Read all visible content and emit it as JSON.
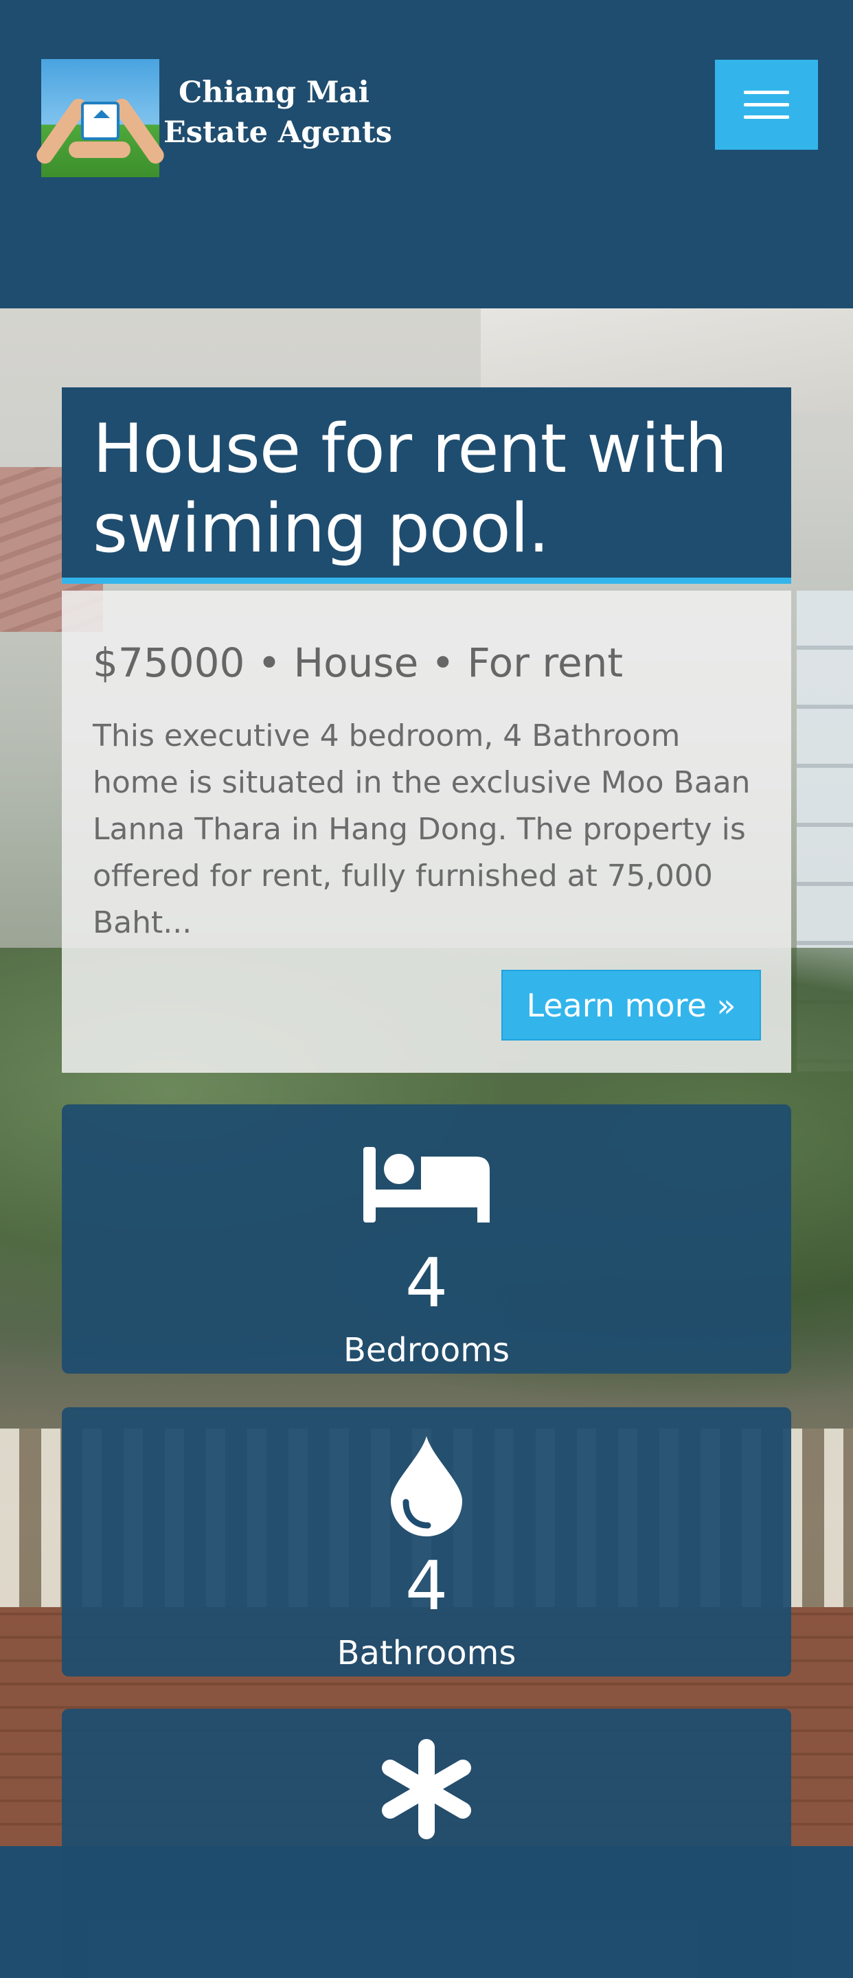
{
  "header": {
    "logo_line1": "Chiang Mai",
    "logo_line2": "Estate Agents",
    "logo_icon": "house-in-hands-logo",
    "menu_icon": "hamburger-menu-icon",
    "menu_color": "#33b5ec",
    "background_color": "#1f4d6f"
  },
  "listing": {
    "title": "House for rent with swiming pool.",
    "meta": "$75000 • House • For rent",
    "description": "This executive 4 bedroom, 4 Bathroom home is situated in the exclusive Moo Baan Lanna Thara in Hang Dong. The property is offered for rent, fully furnished at 75,000 Baht...",
    "learn_more": "Learn more »",
    "accent_color": "#33b5ec"
  },
  "features": [
    {
      "icon": "bed-icon",
      "value": "4",
      "label": "Bedrooms"
    },
    {
      "icon": "water-drop-icon",
      "value": "4",
      "label": "Bathrooms"
    },
    {
      "icon": "asterisk-icon",
      "value": "",
      "label": ""
    }
  ]
}
